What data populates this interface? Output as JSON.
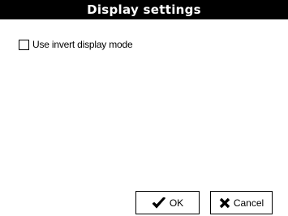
{
  "window": {
    "title": "Display settings"
  },
  "options": {
    "invert_display": {
      "label": "Use invert display mode",
      "checked": false
    }
  },
  "buttons": {
    "ok_label": "OK",
    "cancel_label": "Cancel"
  },
  "icons": {
    "ok": "checkmark-icon",
    "cancel": "x-icon"
  },
  "colors": {
    "title_bg": "#000000",
    "title_fg": "#ffffff",
    "background": "#ffffff"
  }
}
